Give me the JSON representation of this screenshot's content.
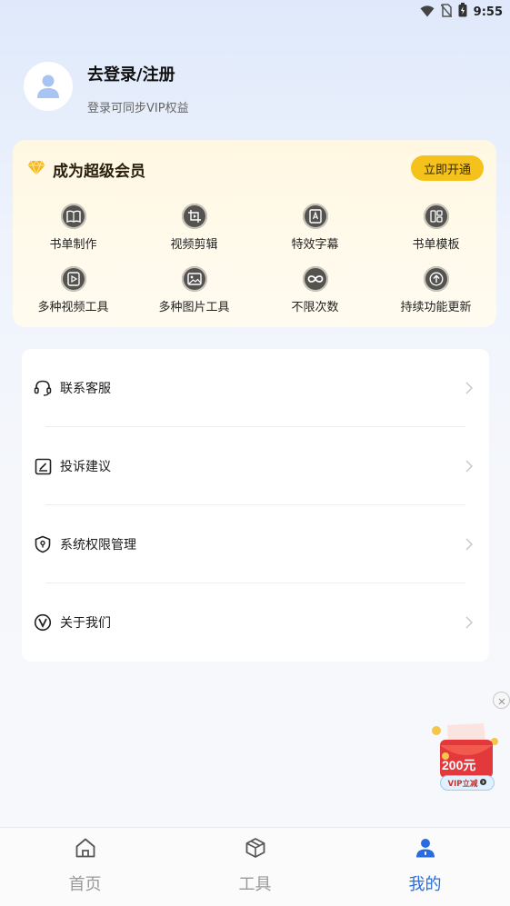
{
  "status_bar": {
    "time": "9:55",
    "icons": [
      "wifi-icon",
      "no-sim-icon",
      "battery-icon"
    ]
  },
  "profile": {
    "title": "去登录/注册",
    "subtitle": "登录可同步VIP权益",
    "avatar_icon": "user-avatar-icon"
  },
  "vip": {
    "title": "成为超级会员",
    "button": "立即开通",
    "features": [
      {
        "label": "书单制作",
        "icon": "book-icon"
      },
      {
        "label": "视频剪辑",
        "icon": "video-crop-icon"
      },
      {
        "label": "特效字幕",
        "icon": "subtitle-icon"
      },
      {
        "label": "书单模板",
        "icon": "template-grid-icon"
      },
      {
        "label": "多种视频工具",
        "icon": "video-play-icon"
      },
      {
        "label": "多种图片工具",
        "icon": "image-icon"
      },
      {
        "label": "不限次数",
        "icon": "infinity-icon"
      },
      {
        "label": "持续功能更新",
        "icon": "upgrade-arrow-icon"
      }
    ],
    "accent": "#f4c21a"
  },
  "menu": {
    "items": [
      {
        "label": "联系客服",
        "icon": "headset-icon"
      },
      {
        "label": "投诉建议",
        "icon": "edit-note-icon"
      },
      {
        "label": "系统权限管理",
        "icon": "shield-location-icon"
      },
      {
        "label": "关于我们",
        "icon": "v-logo-icon"
      }
    ]
  },
  "ad": {
    "amount": "200元",
    "tag": "VIP立减"
  },
  "tabs": [
    {
      "label": "首页",
      "icon": "home-icon",
      "active": false
    },
    {
      "label": "工具",
      "icon": "box-icon",
      "active": false
    },
    {
      "label": "我的",
      "icon": "profile-icon",
      "active": true
    }
  ],
  "colors": {
    "active_tab": "#2a6ce0",
    "vip_button": "#f4c21a"
  }
}
